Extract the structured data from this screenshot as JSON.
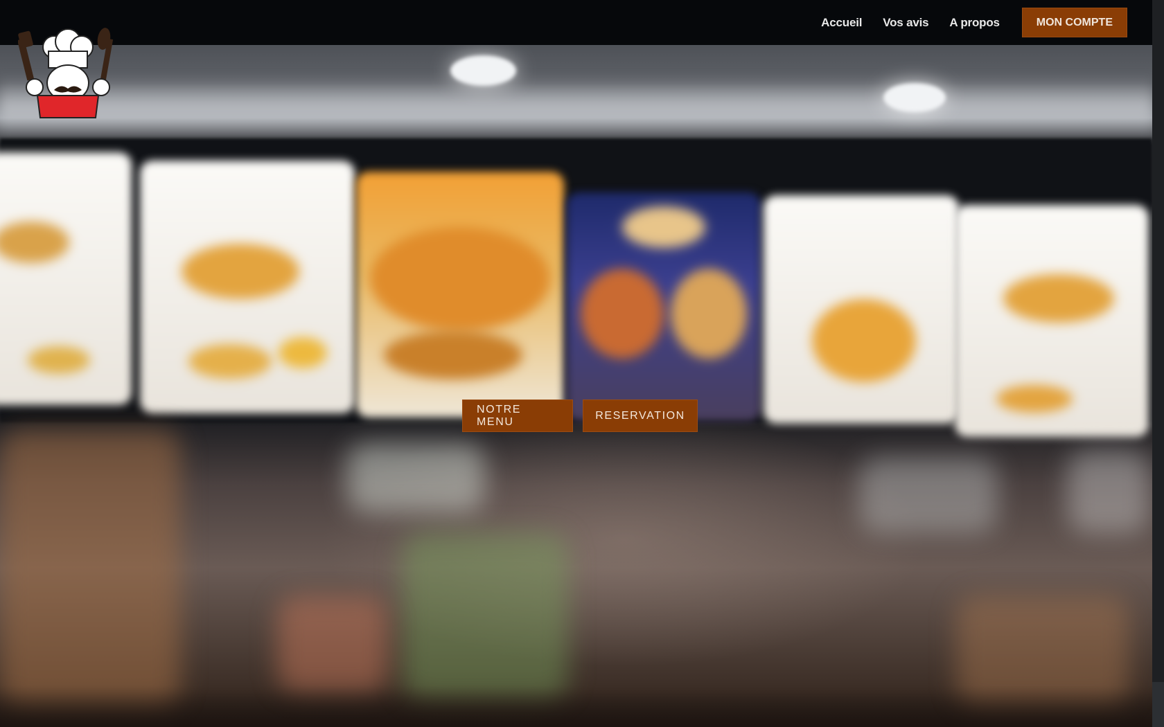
{
  "nav": {
    "links": [
      "Accueil",
      "Vos avis",
      "A propos"
    ],
    "account_label": "MON COMPTE"
  },
  "hero": {
    "menu_button": "NOTRE MENU",
    "reservation_button": "RESERVATION"
  },
  "logo": {
    "icon": "chef-mascot-icon"
  },
  "colors": {
    "accent": "#8a3d05",
    "topbar": "#06080b",
    "nav_text": "#e8e8e8"
  }
}
